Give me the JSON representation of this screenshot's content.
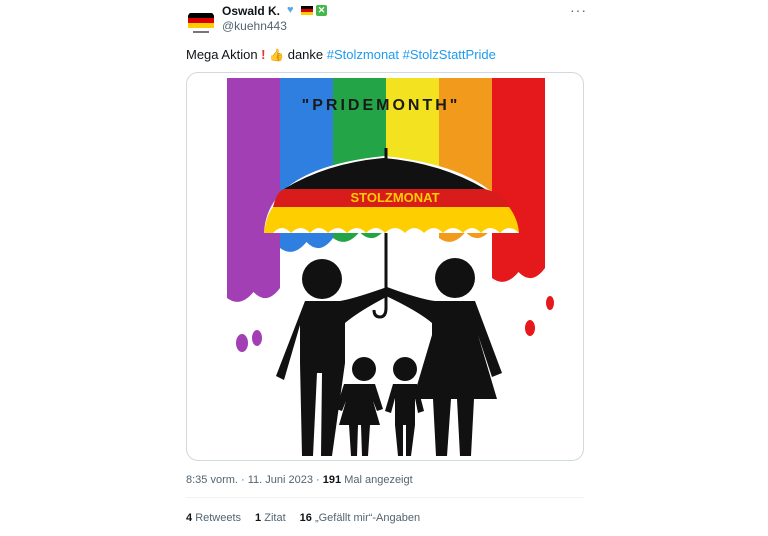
{
  "author": {
    "display_name": "Oswald K.",
    "handle": "@kuehn443",
    "badges": [
      "blue-heart-icon",
      "german-flag-icon",
      "green-x-icon"
    ]
  },
  "tweet": {
    "text_prefix": "Mega Aktion",
    "text_middle": "danke",
    "hashtag_1": "#Stolzmonat",
    "hashtag_2": "#StolzStattPride"
  },
  "image": {
    "top_text": "\"PRIDEMONTH\"",
    "umbrella_text": "STOLZMONAT",
    "rainbow_colors": [
      "#a33fb4",
      "#2f7fe0",
      "#22a447",
      "#f2e21f",
      "#f29a1b",
      "#e5191c"
    ]
  },
  "meta": {
    "time": "8:35 vorm. · 11. Juni 2023 ·",
    "views_count": "191",
    "views_label": "Mal angezeigt"
  },
  "stats": {
    "retweets_count": "4",
    "retweets_label": "Retweets",
    "quotes_count": "1",
    "quotes_label": "Zitat",
    "likes_count": "16",
    "likes_label": "„Gefällt mir“-Angaben"
  },
  "colors": {
    "link": "#1d9bf0",
    "secondary_text": "#536471",
    "border": "#cfd9de",
    "flag_black": "#000000",
    "flag_red": "#dd0000",
    "flag_gold": "#ffce00"
  }
}
